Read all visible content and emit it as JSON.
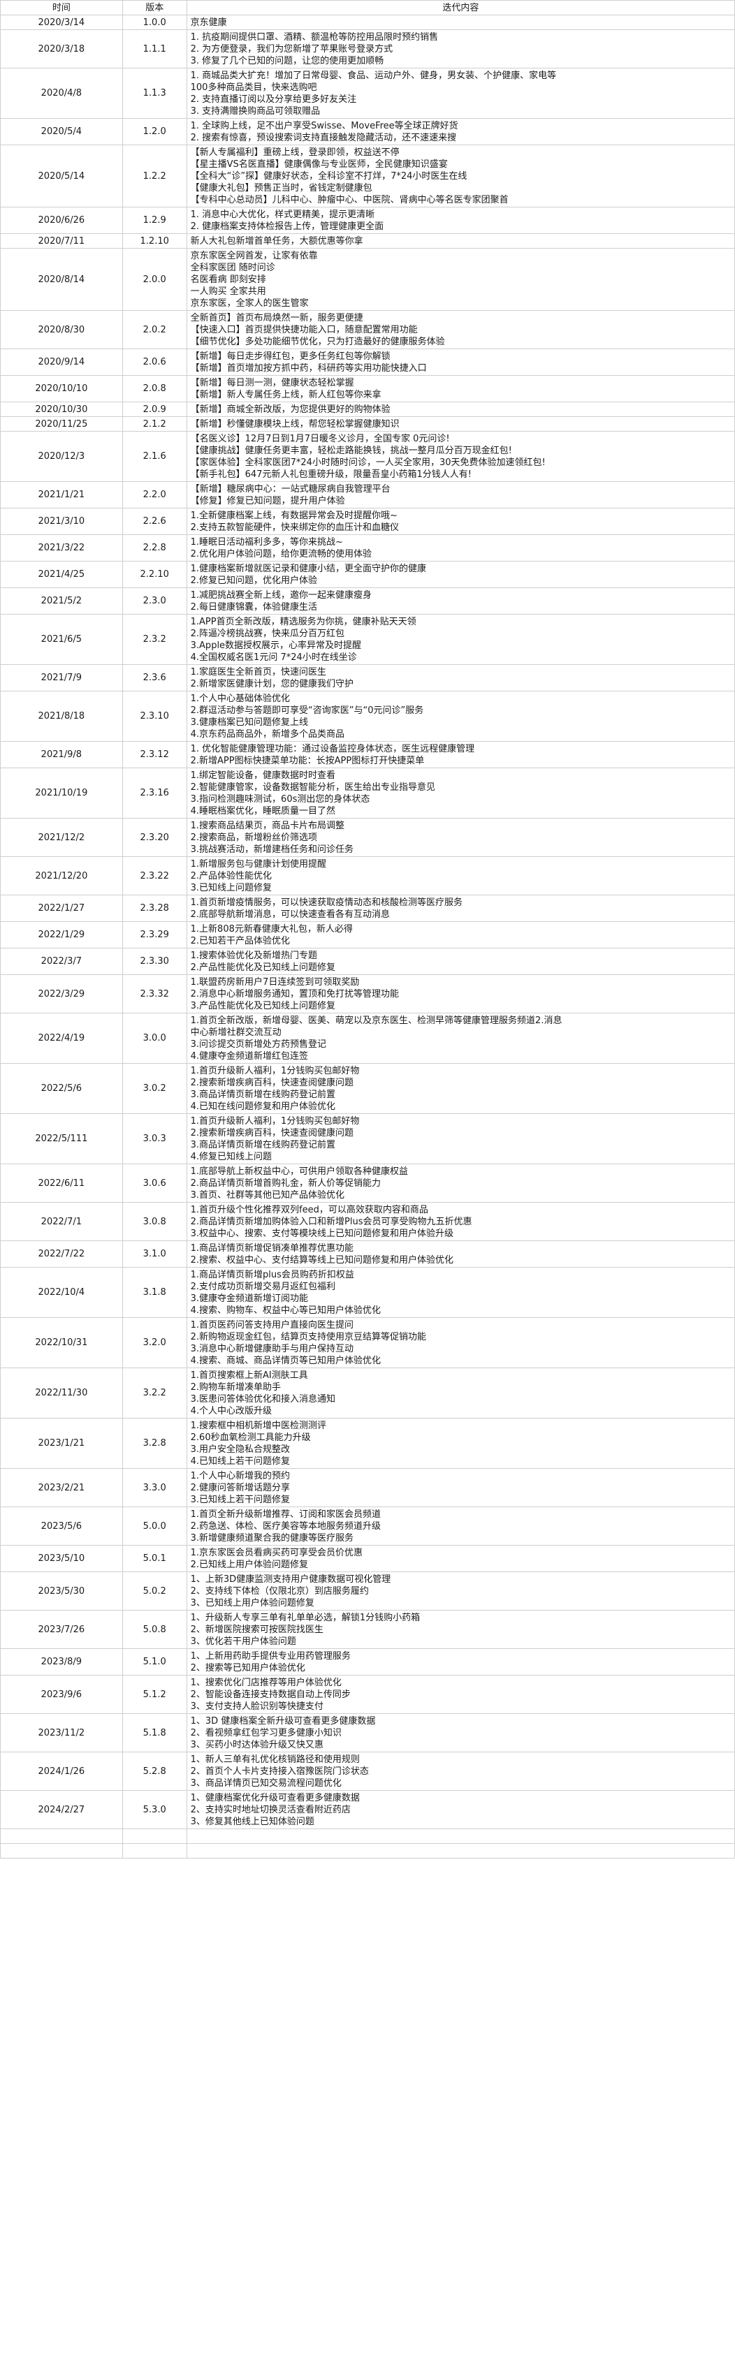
{
  "headers": {
    "date": "时间",
    "version": "版本",
    "content": "迭代内容"
  },
  "rows": [
    {
      "date": "2020/3/14",
      "version": "1.0.0",
      "lines": [
        "京东健康"
      ]
    },
    {
      "date": "2020/3/18",
      "version": "1.1.1",
      "lines": [
        "1. 抗疫期间提供口罩、酒精、额温枪等防控用品限时预约销售",
        "2. 为方便登录，我们为您新增了苹果账号登录方式",
        "3. 修复了几个已知的问题，让您的使用更加顺畅"
      ]
    },
    {
      "date": "2020/4/8",
      "version": "1.1.3",
      "lines": [
        "1. 商城品类大扩充！增加了日常母婴、食品、运动户外、健身，男女装、个护健康、家电等",
        "100多种商品类目，快来选购吧",
        "2. 支持直播订阅以及分享给更多好友关注",
        "3. 支持满赠换购商品可领取赠品"
      ]
    },
    {
      "date": "2020/5/4",
      "version": "1.2.0",
      "lines": [
        "1. 全球购上线，足不出户享受Swisse、MoveFree等全球正牌好货",
        "2. 搜索有惊喜，预设搜索词支持直接触发隐藏活动，还不速速来搜"
      ]
    },
    {
      "date": "2020/5/14",
      "version": "1.2.2",
      "lines": [
        "【新人专属福利】重磅上线，登录即领，权益送不停",
        "【星主播VS名医直播】健康偶像与专业医师，全民健康知识盛宴",
        "【全科大“诊”探】健康好状态，全科诊室不打烊，7*24小时医生在线",
        "【健康大礼包】预售正当时，省钱定制健康包",
        "【专科中心总动员】儿科中心、肿瘤中心、中医院、肾病中心等名医专家团聚首"
      ]
    },
    {
      "date": "2020/6/26",
      "version": "1.2.9",
      "lines": [
        "1. 消息中心大优化，样式更精美，提示更清晰",
        "2. 健康档案支持体检报告上传，管理健康更全面"
      ]
    },
    {
      "date": "2020/7/11",
      "version": "1.2.10",
      "lines": [
        "新人大礼包新增首单任务，大额优惠等你拿"
      ]
    },
    {
      "date": "2020/8/14",
      "version": "2.0.0",
      "lines": [
        "京东家医全网首发，让家有依靠",
        "全科家医团 随时问诊",
        "名医看病 即刻安排",
        "一人购买 全家共用",
        "京东家医，全家人的医生管家"
      ]
    },
    {
      "date": "2020/8/30",
      "version": "2.0.2",
      "lines": [
        "全新首页】首页布局焕然一新，服务更便捷",
        "【快速入口】首页提供快捷功能入口，随意配置常用功能",
        "【细节优化】多处功能细节优化，只为打造最好的健康服务体验"
      ]
    },
    {
      "date": "2020/9/14",
      "version": "2.0.6",
      "lines": [
        "【新增】每日走步得红包，更多任务红包等你解锁",
        "【新增】首页增加按方抓中药，科研药等实用功能快捷入口"
      ]
    },
    {
      "date": "2020/10/10",
      "version": "2.0.8",
      "lines": [
        "【新增】每日测一测，健康状态轻松掌握",
        "【新增】新人专属任务上线，新人红包等你来拿"
      ]
    },
    {
      "date": "2020/10/30",
      "version": "2.0.9",
      "lines": [
        "【新增】商城全新改版，为您提供更好的购物体验"
      ]
    },
    {
      "date": "2020/11/25",
      "version": "2.1.2",
      "lines": [
        "【新增】秒懂健康模块上线，帮您轻松掌握健康知识"
      ]
    },
    {
      "date": "2020/12/3",
      "version": "2.1.6",
      "lines": [
        "【名医义诊】12月7日到1月7日暖冬义诊月，全国专家 0元问诊!",
        "【健康挑战】健康任务更丰富，轻松走路能换钱，挑战一整月瓜分百万现金红包!",
        "【家医体验】全科家医团7*24小时随时问诊，一人买全家用，30天免费体验加速领红包!",
        "【新手礼包】647元新人礼包重磅升级，限量吾皇小药箱1分钱人人有!"
      ]
    },
    {
      "date": "2021/1/21",
      "version": "2.2.0",
      "lines": [
        "【新增】糖尿病中心：一站式糖尿病自我管理平台",
        "【修复】修复已知问题，提升用户体验"
      ]
    },
    {
      "date": "2021/3/10",
      "version": "2.2.6",
      "lines": [
        "1.全新健康档案上线，有数据异常会及时提醒你哦~",
        "2.支持五款智能硬件，快来绑定你的血压计和血糖仪"
      ]
    },
    {
      "date": "2021/3/22",
      "version": "2.2.8",
      "lines": [
        "1.睡眠日活动福利多多，等你来挑战~",
        "2.优化用户体验问题，给你更流畅的使用体验"
      ]
    },
    {
      "date": "2021/4/25",
      "version": "2.2.10",
      "lines": [
        "1.健康档案新增就医记录和健康小结，更全面守护你的健康",
        "2.修复已知问题，优化用户体验"
      ]
    },
    {
      "date": "2021/5/2",
      "version": "2.3.0",
      "lines": [
        "1.减肥挑战赛全新上线，邀你一起来健康瘦身",
        "2.每日健康锦囊，体验健康生活"
      ]
    },
    {
      "date": "2021/6/5",
      "version": "2.3.2",
      "lines": [
        "1.APP首页全新改版，精选服务为你挑，健康补贴天天领",
        "2.阵逼冷榜挑战赛，快来瓜分百万红包",
        "3.Apple数据授权展示，心率异常及时提醒",
        "4.全国权威名医1元问 7*24小时在线坐诊"
      ]
    },
    {
      "date": "2021/7/9",
      "version": "2.3.6",
      "lines": [
        "1.家庭医生全新首页，快速问医生",
        "2.新增家医健康计划，您的健康我们守护"
      ]
    },
    {
      "date": "2021/8/18",
      "version": "2.3.10",
      "lines": [
        "1.个人中心基础体验优化",
        "2.群逗活动参与答题即可享受“咨询家医”与“0元问诊”服务",
        "3.健康档案已知问题修复上线",
        "4.京东药品商品外，新增多个品类商品"
      ]
    },
    {
      "date": "2021/9/8",
      "version": "2.3.12",
      "lines": [
        "1. 优化智能健康管理功能：通过设备监控身体状态，医生远程健康管理",
        "2.新增APP图标快捷菜单功能：长按APP图标打开快捷菜单"
      ]
    },
    {
      "date": "2021/10/19",
      "version": "2.3.16",
      "lines": [
        "1.绑定智能设备，健康数据时时查看",
        "2.智能健康管家，设备数据智能分析，医生给出专业指导意见",
        "3.指问检测趣味测试，60s测出您的身体状态",
        "4.睡眠档案优化，睡眠质量一目了然"
      ]
    },
    {
      "date": "2021/12/2",
      "version": "2.3.20",
      "lines": [
        "1.搜索商品结果页，商品卡片布局调整",
        "2.搜索商品，新增粉丝价筛选项",
        "3.挑战赛活动，新增建档任务和问诊任务"
      ]
    },
    {
      "date": "2021/12/20",
      "version": "2.3.22",
      "lines": [
        "1.新增服务包与健康计划使用提醒",
        "2.产品体验性能优化",
        "3.已知线上问题修复"
      ]
    },
    {
      "date": "2022/1/27",
      "version": "2.3.28",
      "lines": [
        "1.首页新增疫情服务，可以快速获取疫情动态和核酸检测等医疗服务",
        "2.底部导航新增消息，可以快速查看各有互动消息"
      ]
    },
    {
      "date": "2022/1/29",
      "version": "2.3.29",
      "lines": [
        "1.上新808元新春健康大礼包，新人必得",
        "2.已知若干产品体验优化"
      ]
    },
    {
      "date": "2022/3/7",
      "version": "2.3.30",
      "lines": [
        "1.搜索体验优化及新增热门专题",
        "2.产品性能优化及已知线上问题修复"
      ]
    },
    {
      "date": "2022/3/29",
      "version": "2.3.32",
      "lines": [
        "1.联盟药房新用户7日连续签到可领取奖励",
        "2.消息中心新增服务通知，置顶和免打扰等管理功能",
        "3.产品性能优化及已知线上问题修复"
      ]
    },
    {
      "date": "2022/4/19",
      "version": "3.0.0",
      "lines": [
        "1.首页全新改版，新增母婴、医美、萌宠以及京东医生、检测早筛等健康管理服务频道2.消息",
        "中心新增社群交流互动",
        "3.问诊提交页新增处方药预售登记",
        "4.健康夺金频道新增红包连签"
      ]
    },
    {
      "date": "2022/5/6",
      "version": "3.0.2",
      "lines": [
        "1.首页升级新人福利，1分钱购买包邮好物",
        "2.搜索新增疾病百科，快速查阅健康问题",
        "3.商品详情页新增在线购药登记前置",
        "4.已知在线问题修复和用户体验优化"
      ]
    },
    {
      "date": "2022/5/111",
      "version": "3.0.3",
      "lines": [
        "1.首页升级新人福利，1分钱购买包邮好物",
        "2.搜索新增疾病百科，快速查阅健康问题",
        "3.商品详情页新增在线购药登记前置",
        "4.修复已知线上问题"
      ]
    },
    {
      "date": "2022/6/11",
      "version": "3.0.6",
      "lines": [
        "1.底部导航上新权益中心，可供用户领取各种健康权益",
        "2.商品详情页新增首购礼金，新人价等促销能力",
        "3.首页、社群等其他已知产品体验优化"
      ]
    },
    {
      "date": "2022/7/1",
      "version": "3.0.8",
      "lines": [
        "1.首页升级个性化推荐双列feed，可以高效获取内容和商品",
        "2.商品详情页新增加购体验入口和新增Plus会员可享受购物九五折优惠",
        "3.权益中心、搜索、支付等模块线上已知问题修复和用户体验升级"
      ]
    },
    {
      "date": "2022/7/22",
      "version": "3.1.0",
      "lines": [
        "1.商品详情页新增促销凑单推荐优惠功能",
        "2.搜索、权益中心、支付结算等线上已知问题修复和用户体验优化"
      ]
    },
    {
      "date": "2022/10/4",
      "version": "3.1.8",
      "lines": [
        "1.商品详情页新增plus会员购药折扣权益",
        "2.支付成功页新增交易月返红包福利",
        "3.健康夺金频道新增订阅功能",
        "4.搜索、购物车、权益中心等已知用户体验优化"
      ]
    },
    {
      "date": "2022/10/31",
      "version": "3.2.0",
      "lines": [
        "1.首页医药问答支持用户直接向医生提问",
        "2.新购物返现金红包，结算页支持使用京豆结算等促销功能",
        "3.消息中心新增健康助手与用户保持互动",
        "4.搜索、商城、商品详情页等已知用户体验优化"
      ]
    },
    {
      "date": "2022/11/30",
      "version": "3.2.2",
      "lines": [
        "1.首页搜索框上新AI测肤工具",
        "2.购物车新增凑单助手",
        "3.医患问答体验优化和接入消息通知",
        "4.个人中心改版升级"
      ]
    },
    {
      "date": "2023/1/21",
      "version": "3.2.8",
      "lines": [
        "1.搜索框中相机新增中医检测测评",
        "2.60秒血氧检测工具能力升级",
        "3.用户安全隐私合规整改",
        "4.已知线上若干问题修复"
      ]
    },
    {
      "date": "2023/2/21",
      "version": "3.3.0",
      "lines": [
        "1.个人中心新增我的预约",
        "2.健康问答新增话题分享",
        "3.已知线上若干问题修复"
      ]
    },
    {
      "date": "2023/5/6",
      "version": "5.0.0",
      "lines": [
        "1.首页全新升级新增推荐、订阅和家医会员频道",
        "2.药急送、体检、医疗美容等本地服务频道升级",
        "3.新增健康频道聚合我的健康等医疗服务"
      ]
    },
    {
      "date": "2023/5/10",
      "version": "5.0.1",
      "lines": [
        "1.京东家医会员看病买药可享受会员价优惠",
        "2.已知线上用户体验问题修复"
      ]
    },
    {
      "date": "2023/5/30",
      "version": "5.0.2",
      "lines": [
        "1、上新3D健康监测支持用户健康数据可视化管理",
        "2、支持线下体检（仅限北京）到店服务履约",
        "3、已知线上用户体验问题修复"
      ]
    },
    {
      "date": "2023/7/26",
      "version": "5.0.8",
      "lines": [
        "1、升级新人专享三单有礼单单必选，解锁1分钱购小药箱",
        "2、新增医院搜索可按医院找医生",
        "3、优化若干用户体验问题"
      ]
    },
    {
      "date": "2023/8/9",
      "version": "5.1.0",
      "lines": [
        "1、上新用药助手提供专业用药管理服务",
        "2、搜索等已知用户体验优化"
      ]
    },
    {
      "date": "2023/9/6",
      "version": "5.1.2",
      "lines": [
        "1、搜索优化门店推荐等用户体验优化",
        "2、智能设备连接支持数据自动上传同步",
        "3、支付支持人脸识别等快捷支付"
      ]
    },
    {
      "date": "2023/11/2",
      "version": "5.1.8",
      "lines": [
        "1、3D 健康档案全新升级可查看更多健康数据",
        "2、看视频拿红包学习更多健康小知识",
        "3、买药小时达体验升级又快又惠"
      ]
    },
    {
      "date": "2024/1/26",
      "version": "5.2.8",
      "lines": [
        "1、新人三单有礼优化核销路径和使用规则",
        "2、首页个人卡片支持接入宿豫医院门诊状态",
        "3、商品详情页已知交易流程问题优化"
      ]
    },
    {
      "date": "2024/2/27",
      "version": "5.3.0",
      "lines": [
        "1、健康档案优化升级可查看更多健康数据",
        "2、支持实时地址切换灵活查看附近药店",
        "3、修复其他线上已知体验问题"
      ]
    },
    {
      "date": "",
      "version": "",
      "lines": [
        ""
      ]
    },
    {
      "date": "",
      "version": "",
      "lines": [
        ""
      ]
    }
  ]
}
